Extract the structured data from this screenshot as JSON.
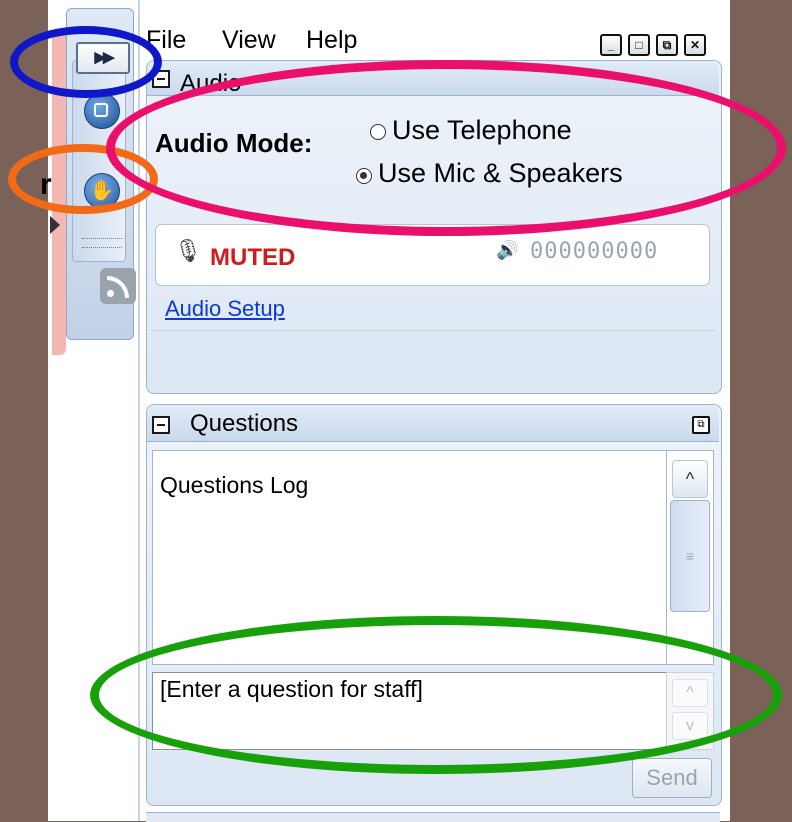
{
  "menu": {
    "file": "File",
    "view": "View",
    "help": "Help"
  },
  "window_controls": [
    "minimize",
    "maximize",
    "restore",
    "close"
  ],
  "toolbar": {
    "collapse_icon": "fast-forward-icon",
    "stop_icon": "stop-icon",
    "raise_hand_icon": "raise-hand-icon",
    "rss_icon": "rss-icon"
  },
  "audio": {
    "title": "Audio",
    "mode_label": "Audio Mode:",
    "options": [
      {
        "label": "Use Telephone",
        "selected": false
      },
      {
        "label": "Use Mic & Speakers",
        "selected": true
      }
    ],
    "mic_status": "MUTED",
    "level_digits": "000000000",
    "setup_link": "Audio Setup"
  },
  "questions": {
    "title": "Questions",
    "log_text": "Questions Log",
    "input_placeholder": "[Enter a question for staff]",
    "send_label": "Send"
  },
  "left_panel": {
    "fragment": "r"
  },
  "colors": {
    "background": "#7a6259",
    "muted": "#d11a1a",
    "link": "#0b3ad6",
    "annotation_blue": "#1017c9",
    "annotation_orange": "#f26a16",
    "annotation_pink": "#ea0f6b",
    "annotation_green": "#17a00a"
  }
}
